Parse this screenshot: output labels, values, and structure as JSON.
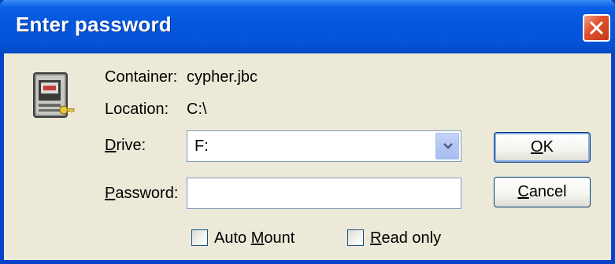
{
  "window": {
    "title": "Enter password"
  },
  "icons": {
    "app": "encrypted-container-key-icon",
    "close": "close-icon",
    "dropdown": "chevron-down-icon"
  },
  "info": {
    "container_label": "Container:",
    "container_value": "cypher.jbc",
    "location_label": "Location:",
    "location_value": "C:\\"
  },
  "drive": {
    "label_mnemonic": "D",
    "label_rest": "rive:",
    "selected": "F:"
  },
  "password": {
    "label_mnemonic": "P",
    "label_rest": "assword:",
    "value": ""
  },
  "buttons": {
    "ok_mnemonic": "O",
    "ok_rest": "K",
    "cancel_mnemonic": "C",
    "cancel_rest": "ancel"
  },
  "options": {
    "auto_mount_prefix": "Auto ",
    "auto_mount_mnemonic": "M",
    "auto_mount_rest": "ount",
    "auto_mount_checked": false,
    "read_only_mnemonic": "R",
    "read_only_rest": "ead only",
    "read_only_checked": false
  },
  "colors": {
    "titlebar": "#0556dc",
    "dialog_bg": "#ece9d8",
    "close_red": "#e2512e"
  }
}
